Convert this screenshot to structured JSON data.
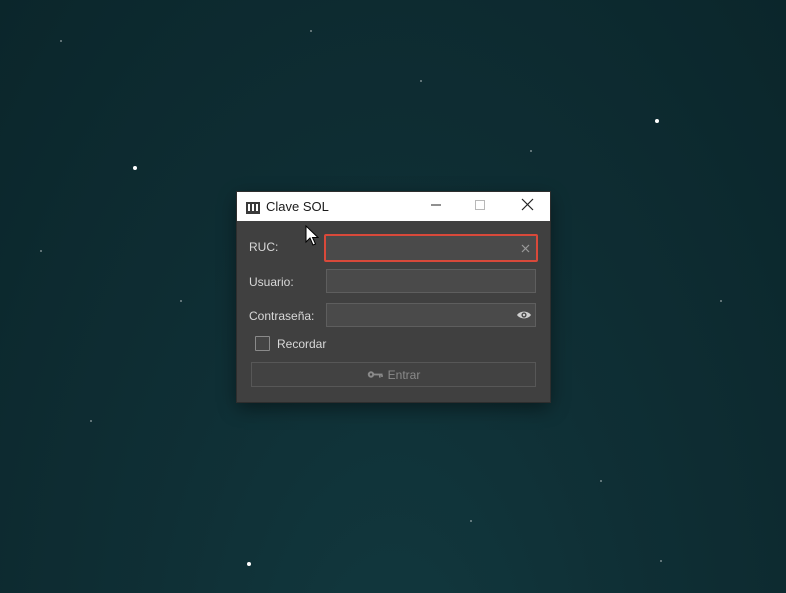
{
  "window": {
    "title": "Clave SOL",
    "app_icon": "bar-chart-icon",
    "controls": [
      "minimize-icon",
      "maximize-icon",
      "close-icon"
    ]
  },
  "form": {
    "ruc": {
      "label": "RUC:",
      "value": "",
      "placeholder": "",
      "state": "error",
      "clear_icon": "clear-icon"
    },
    "usuario": {
      "label": "Usuario:",
      "value": "",
      "placeholder": ""
    },
    "contrasena": {
      "label": "Contraseña:",
      "value": "",
      "placeholder": "",
      "toggle_icon": "eye-icon"
    },
    "remember": {
      "label": "Recordar",
      "checked": false
    },
    "submit": {
      "label": "Entrar",
      "icon": "key-icon",
      "enabled": false
    }
  },
  "colors": {
    "desktop": "#0f2f35",
    "window_body": "#404040",
    "titlebar": "#ffffff",
    "error_border": "#d9493a",
    "text": "#d8d8d8",
    "disabled_text": "#8a8a8a"
  }
}
